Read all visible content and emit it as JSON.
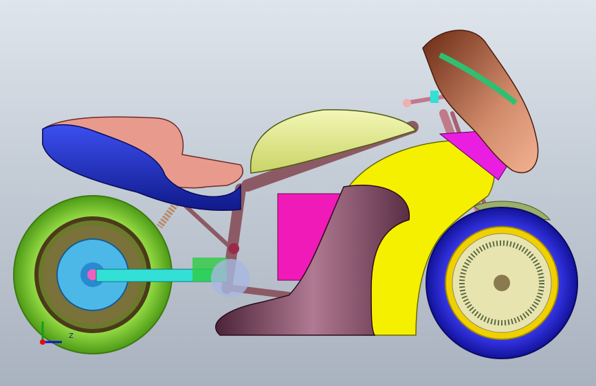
{
  "viewport": {
    "background_top": "#dfe5ec",
    "background_bottom": "#a9b2bf"
  },
  "colors": {
    "tank_seat": "#e8ef9a",
    "rear_cowl_blue": "#1d2fc9",
    "rear_cowl_pink": "#e89b8c",
    "frame": "#8c5a64",
    "fairing_yellow": "#f5f000",
    "fairing_dark": "#6b3d50",
    "battery_magenta": "#f01ab8",
    "rear_tire": "#7ecb2e",
    "front_tire": "#2222cc",
    "front_rim": "#f0d000",
    "swingarm": "#33e0d6",
    "windscreen": "#c0785a"
  },
  "triad": {
    "z_label": "Z",
    "x_color": "#e01010",
    "y_color": "#10a010",
    "z_color": "#1010e0"
  }
}
